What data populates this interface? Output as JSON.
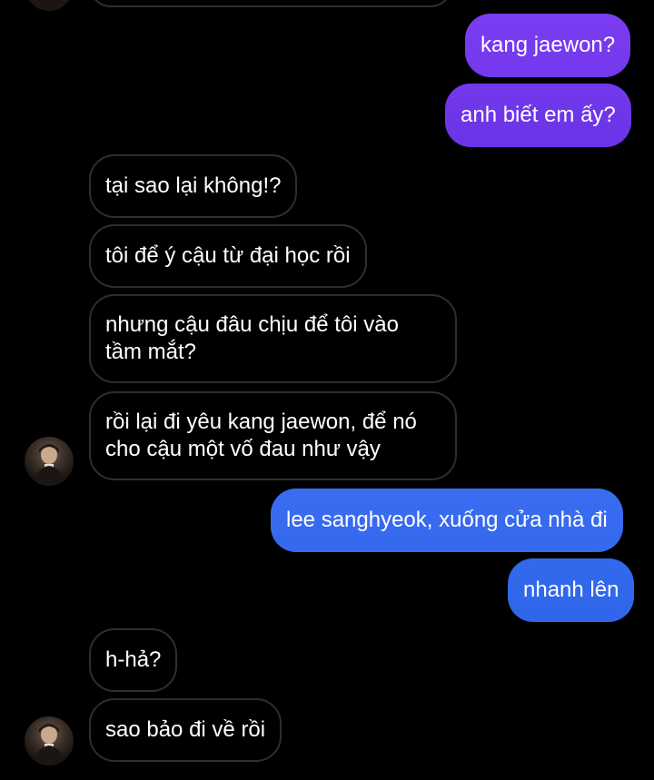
{
  "colors": {
    "background": "#000000",
    "incoming_border": "#2e2e2e",
    "outgoing_purple_top": "#7a3df0",
    "outgoing_purple_bottom": "#6b34e6",
    "outgoing_blue_top": "#3a6cf0",
    "outgoing_blue_bottom": "#2f66ea"
  },
  "messages": [
    {
      "direction": "out",
      "text": "kang jaewon?"
    },
    {
      "direction": "out",
      "text": "anh biết em ấy?"
    },
    {
      "direction": "in",
      "text": "tại sao lại không!?"
    },
    {
      "direction": "in",
      "text": "tôi để ý cậu từ đại học rồi"
    },
    {
      "direction": "in",
      "lines": [
        "nhưng cậu đâu chịu để tôi vào",
        "tầm mắt?"
      ]
    },
    {
      "direction": "in",
      "lines": [
        "rồi lại đi yêu kang jaewon, để nó",
        "cho cậu một vố đau như vậy"
      ]
    },
    {
      "direction": "out",
      "text": "lee sanghyeok, xuống cửa nhà đi"
    },
    {
      "direction": "out",
      "text": "nhanh lên"
    },
    {
      "direction": "in",
      "text": "h-hả?"
    },
    {
      "direction": "in",
      "text": "sao bảo đi về rồi"
    }
  ],
  "avatar_icon": "contact-avatar-photo"
}
